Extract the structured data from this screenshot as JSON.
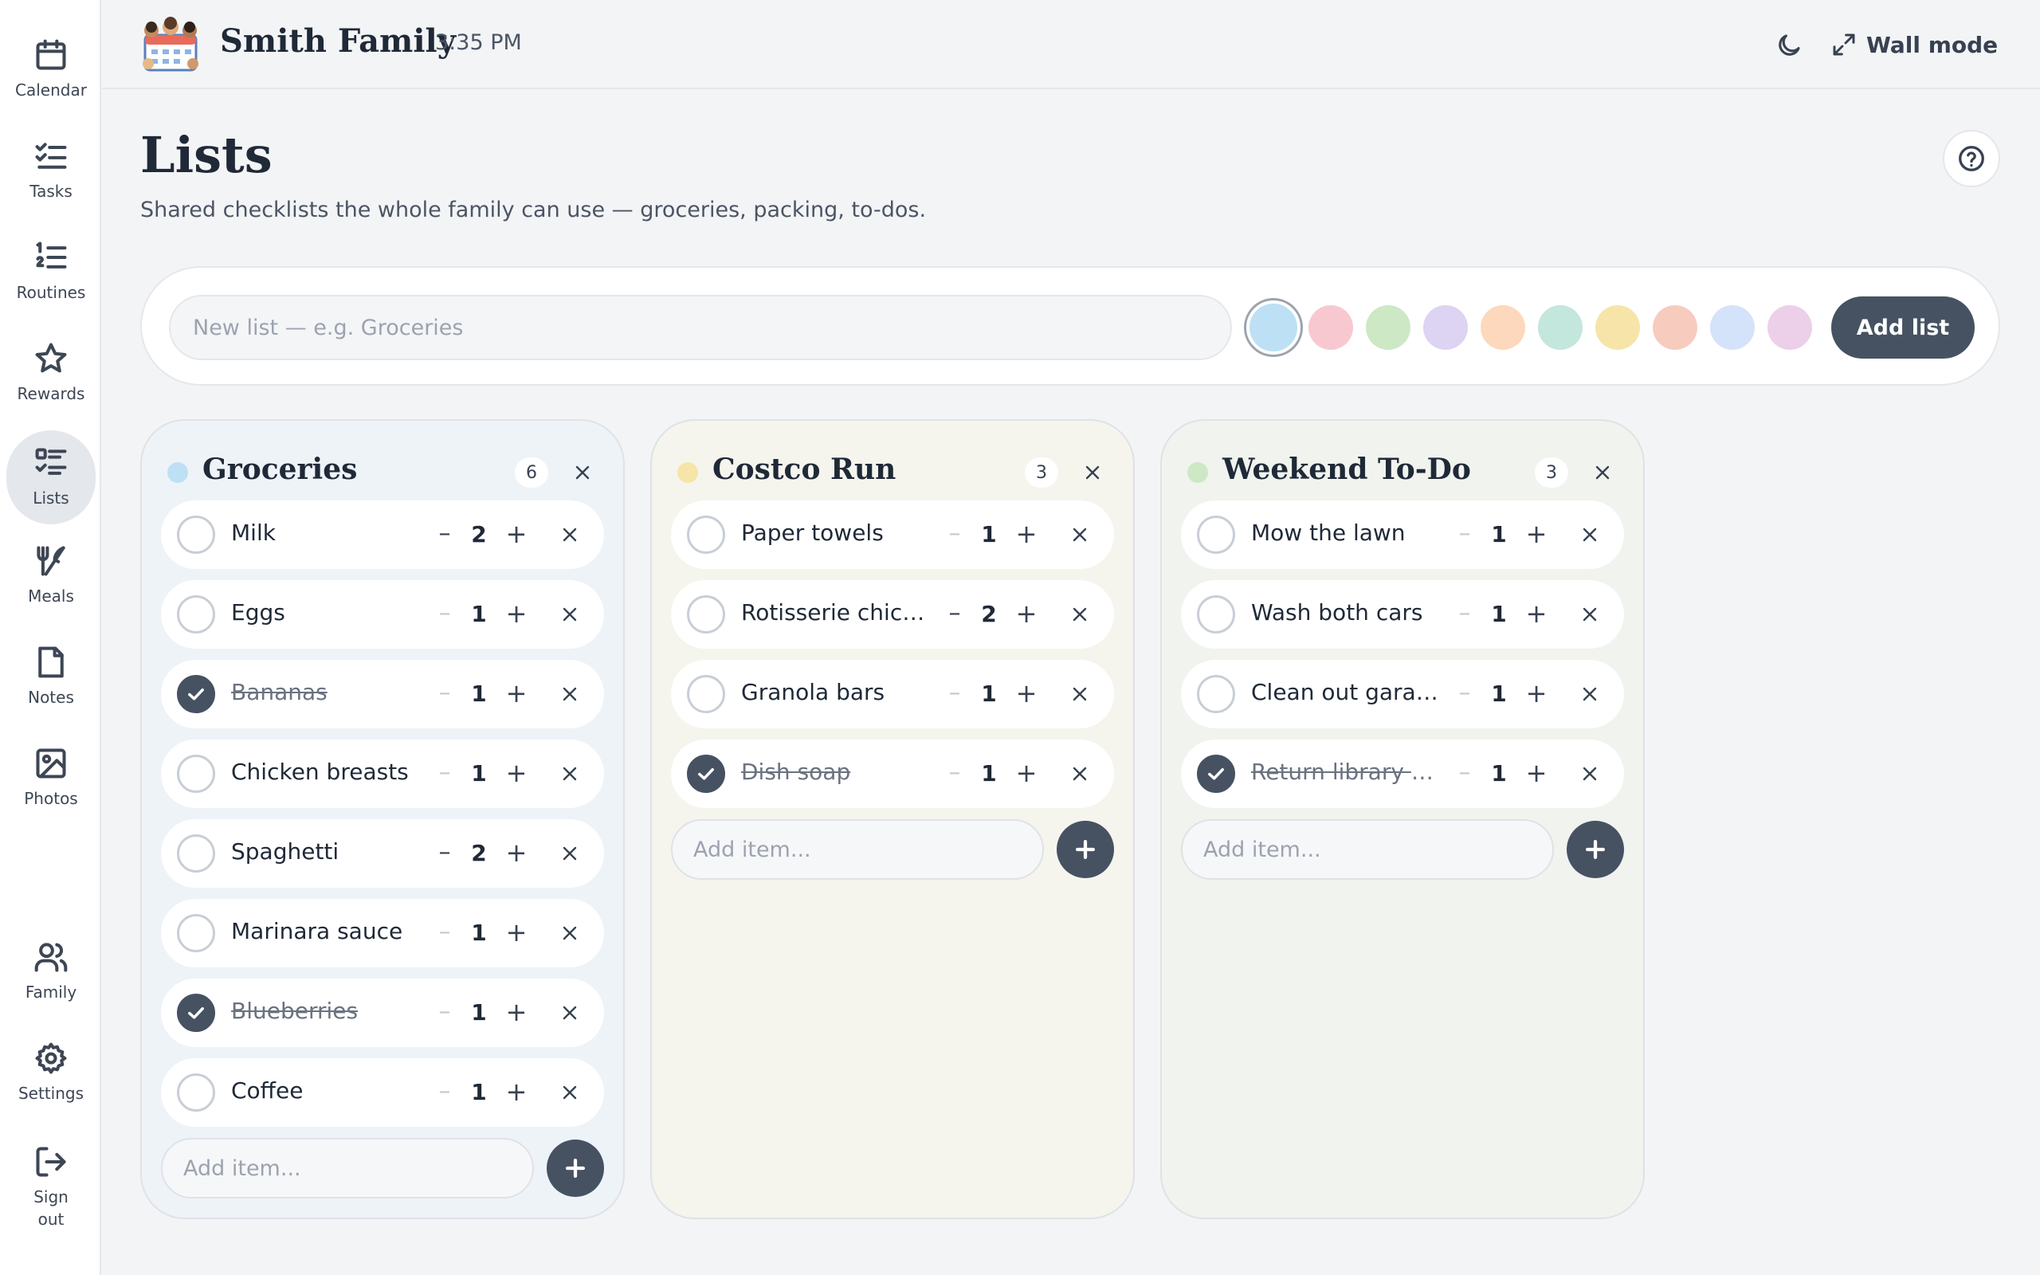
{
  "sidebar": {
    "items": [
      {
        "label": "Calendar",
        "icon": "calendar-icon",
        "active": false
      },
      {
        "label": "Tasks",
        "icon": "tasks-icon",
        "active": false
      },
      {
        "label": "Routines",
        "icon": "routines-icon",
        "active": false
      },
      {
        "label": "Rewards",
        "icon": "star-icon",
        "active": false
      },
      {
        "label": "Lists",
        "icon": "lists-icon",
        "active": true
      },
      {
        "label": "Meals",
        "icon": "utensils-icon",
        "active": false
      },
      {
        "label": "Notes",
        "icon": "note-icon",
        "active": false
      },
      {
        "label": "Photos",
        "icon": "image-icon",
        "active": false
      }
    ],
    "bottom_items": [
      {
        "label": "Family",
        "icon": "users-icon"
      },
      {
        "label": "Settings",
        "icon": "gear-icon"
      },
      {
        "label": "Sign out",
        "icon": "sign-out-icon"
      }
    ]
  },
  "header": {
    "family_name": "Smith Family",
    "time": "3:35 PM",
    "wall_mode_label": "Wall mode"
  },
  "page": {
    "title": "Lists",
    "subtitle": "Shared checklists the whole family can use — groceries, packing, to-dos."
  },
  "new_list": {
    "placeholder": "New list — e.g. Groceries",
    "add_label": "Add list",
    "colors": [
      "#bde0f5",
      "#f8c8d0",
      "#cde8c5",
      "#ddd3f2",
      "#fdd8bd",
      "#c3e6dd",
      "#f7e4a8",
      "#f8cbbf",
      "#d4e3fa",
      "#ecd0ea"
    ],
    "selected_color_index": 0
  },
  "add_item_placeholder": "Add item...",
  "lists": [
    {
      "title": "Groceries",
      "count": "6",
      "color": "#bde0f5",
      "background": "#eef3f8",
      "items": [
        {
          "name": "Milk",
          "qty": "2",
          "done": false
        },
        {
          "name": "Eggs",
          "qty": "1",
          "done": false
        },
        {
          "name": "Bananas",
          "qty": "1",
          "done": true
        },
        {
          "name": "Chicken breasts",
          "qty": "1",
          "done": false
        },
        {
          "name": "Spaghetti",
          "qty": "2",
          "done": false
        },
        {
          "name": "Marinara sauce",
          "qty": "1",
          "done": false
        },
        {
          "name": "Blueberries",
          "qty": "1",
          "done": true
        },
        {
          "name": "Coffee",
          "qty": "1",
          "done": false
        }
      ]
    },
    {
      "title": "Costco Run",
      "count": "3",
      "color": "#f7e4a8",
      "background": "#f5f5ee",
      "items": [
        {
          "name": "Paper towels",
          "qty": "1",
          "done": false
        },
        {
          "name": "Rotisserie chick...",
          "qty": "2",
          "done": false
        },
        {
          "name": "Granola bars",
          "qty": "1",
          "done": false
        },
        {
          "name": "Dish soap",
          "qty": "1",
          "done": true
        }
      ]
    },
    {
      "title": "Weekend To-Do",
      "count": "3",
      "color": "#cde8c5",
      "background": "#f0f3ee",
      "items": [
        {
          "name": "Mow the lawn",
          "qty": "1",
          "done": false
        },
        {
          "name": "Wash both cars",
          "qty": "1",
          "done": false
        },
        {
          "name": "Clean out garage",
          "qty": "1",
          "done": false
        },
        {
          "name": "Return library b...",
          "qty": "1",
          "done": true
        }
      ]
    }
  ]
}
